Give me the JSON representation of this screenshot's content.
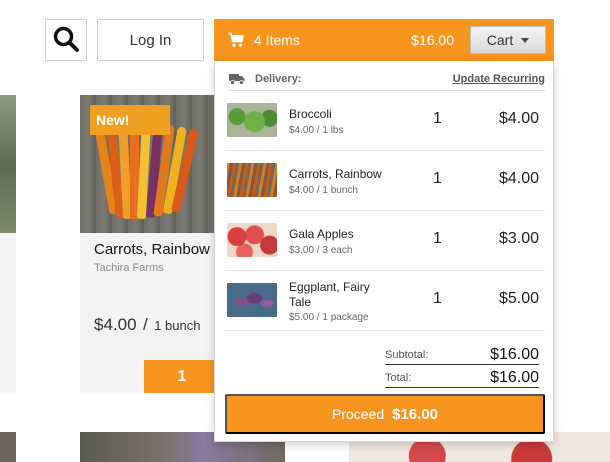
{
  "header": {
    "login_label": "Log In"
  },
  "cart": {
    "items_label": "4 Items",
    "total": "$16.00",
    "toggle_label": "Cart",
    "delivery_label": "Delivery:",
    "update_recurring_label": "Update Recurring",
    "items": [
      {
        "name": "Broccoli",
        "unit_price": "$4.00 / 1 lbs",
        "qty": "1",
        "price": "$4.00",
        "thumb": "broccoli"
      },
      {
        "name": "Carrots, Rainbow",
        "unit_price": "$4.00 / 1 bunch",
        "qty": "1",
        "price": "$4.00",
        "thumb": "carrots"
      },
      {
        "name": "Gala Apples",
        "unit_price": "$3.00 / 3 each",
        "qty": "1",
        "price": "$3.00",
        "thumb": "apples"
      },
      {
        "name": "Eggplant, Fairy Tale",
        "unit_price": "$5.00 / 1 package",
        "qty": "1",
        "price": "$5.00",
        "thumb": "eggplant"
      }
    ],
    "subtotal_label": "Subtotal:",
    "subtotal_value": "$16.00",
    "total_label": "Total:",
    "total_value": "$16.00",
    "proceed_label": "Proceed",
    "proceed_amount": "$16.00"
  },
  "product": {
    "badge": "New!",
    "name": "Carrots, Rainbow",
    "farm": "Tachira Farms",
    "price": "$4.00",
    "separator": "/",
    "unit": "1 bunch",
    "qty": "1"
  },
  "colors": {
    "accent": "#f7941d",
    "badge": "#f0a020"
  },
  "icons": {
    "search": "search-icon",
    "cart": "shopping-cart-icon",
    "truck": "truck-icon",
    "caret": "chevron-down-icon"
  }
}
